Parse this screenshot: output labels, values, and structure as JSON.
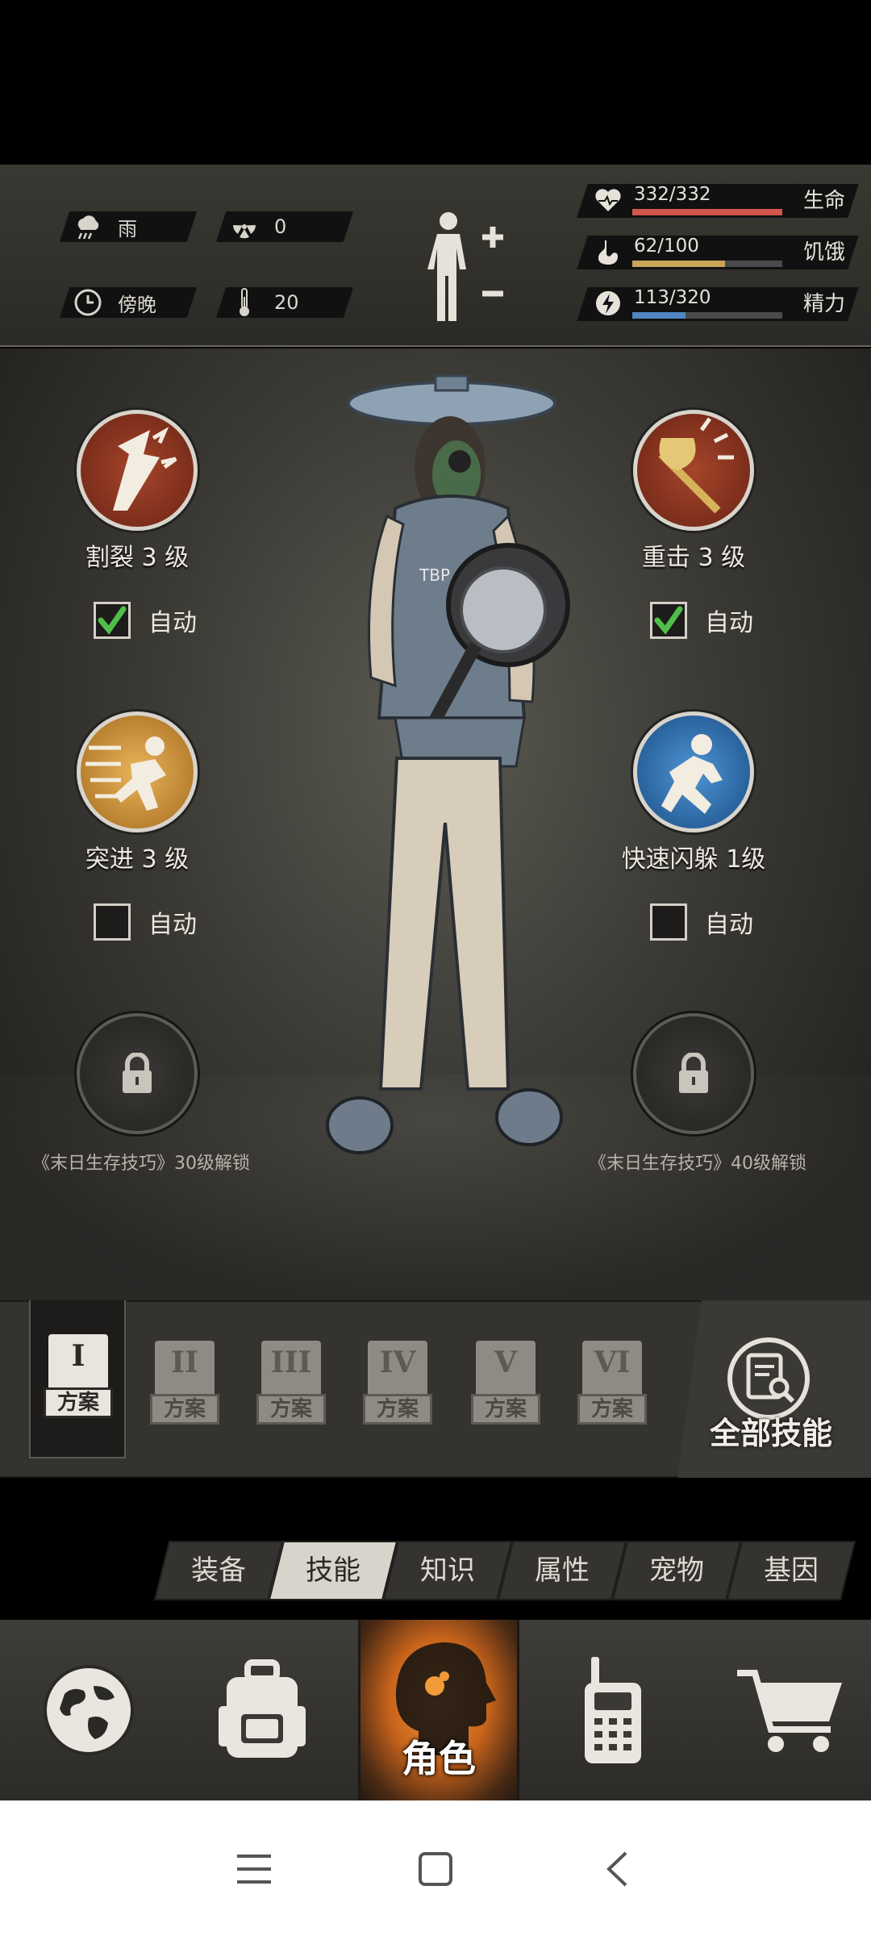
{
  "status": {
    "weather": {
      "label": "雨",
      "icon": "rain-cloud-icon"
    },
    "radiation": {
      "label": "0",
      "icon": "radiation-icon"
    },
    "time": {
      "label": "傍晚",
      "icon": "clock-icon"
    },
    "temperature": {
      "label": "20",
      "icon": "thermometer-icon"
    }
  },
  "vitals": [
    {
      "label": "生命",
      "value": "332/332",
      "fraction": 1.0,
      "color": "#d2574a",
      "icon": "heart-pulse-icon"
    },
    {
      "label": "饥饿",
      "value": "62/100",
      "fraction": 0.62,
      "color": "#c8a657",
      "icon": "stomach-icon"
    },
    {
      "label": "精力",
      "value": "113/320",
      "fraction": 0.353,
      "color": "#4f86c3",
      "icon": "energy-icon"
    }
  ],
  "skills": {
    "slot1": {
      "name": "割裂 3 级",
      "auto_label": "自动",
      "auto": true,
      "icon": "laceration-skill-icon"
    },
    "slot2": {
      "name": "重击 3 级",
      "auto_label": "自动",
      "auto": true,
      "icon": "heavy-strike-skill-icon"
    },
    "slot3": {
      "name": "突进 3 级",
      "auto_label": "自动",
      "auto": false,
      "icon": "dash-skill-icon"
    },
    "slot4": {
      "name": "快速闪躲 1级",
      "auto_label": "自动",
      "auto": false,
      "icon": "quick-dodge-skill-icon"
    },
    "locked1": {
      "unlock_text": "《末日生存技巧》30级解锁",
      "icon": "lock-icon"
    },
    "locked2": {
      "unlock_text": "《末日生存技巧》40级解锁",
      "icon": "lock-icon"
    }
  },
  "plans": [
    {
      "numeral": "I",
      "label": "方案",
      "active": true
    },
    {
      "numeral": "II",
      "label": "方案",
      "active": false
    },
    {
      "numeral": "III",
      "label": "方案",
      "active": false
    },
    {
      "numeral": "IV",
      "label": "方案",
      "active": false
    },
    {
      "numeral": "V",
      "label": "方案",
      "active": false
    },
    {
      "numeral": "VI",
      "label": "方案",
      "active": false
    }
  ],
  "all_skills": {
    "label": "全部技能",
    "icon": "document-search-icon"
  },
  "tabs": [
    {
      "label": "装备",
      "active": false
    },
    {
      "label": "技能",
      "active": true
    },
    {
      "label": "知识",
      "active": false
    },
    {
      "label": "属性",
      "active": false
    },
    {
      "label": "宠物",
      "active": false
    },
    {
      "label": "基因",
      "active": false
    }
  ],
  "nav": {
    "world": {
      "icon": "globe-icon"
    },
    "backpack": {
      "icon": "backpack-icon"
    },
    "role": {
      "label": "角色",
      "icon": "head-profile-icon"
    },
    "radio": {
      "icon": "walkie-talkie-icon"
    },
    "shop": {
      "icon": "shopping-cart-icon"
    }
  },
  "system_nav": {
    "menu": "menu-icon",
    "home": "home-icon",
    "back": "back-icon"
  }
}
